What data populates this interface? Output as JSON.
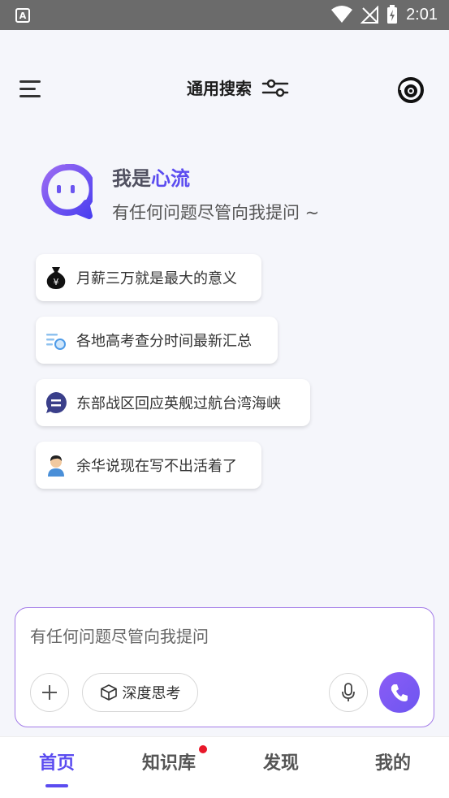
{
  "status_bar": {
    "app_badge": "A",
    "time": "2:01"
  },
  "header": {
    "title": "通用搜索"
  },
  "intro": {
    "title_prefix": "我是",
    "title_brand": "心流",
    "subtitle": "有任何问题尽管向我提问 ~"
  },
  "suggestions": [
    {
      "icon": "money-bag-icon",
      "text": "月薪三万就是最大的意义"
    },
    {
      "icon": "search-list-icon",
      "text": "各地高考查分时间最新汇总"
    },
    {
      "icon": "chat-bubble-icon",
      "text": "东部战区回应英舰过航台湾海峡"
    },
    {
      "icon": "person-avatar-icon",
      "text": "余华说现在写不出活着了"
    }
  ],
  "composer": {
    "placeholder": "有任何问题尽管向我提问",
    "deep_think_label": "深度思考"
  },
  "tabs": [
    {
      "label": "首页",
      "active": true
    },
    {
      "label": "知识库",
      "active": false,
      "badge": true
    },
    {
      "label": "发现",
      "active": false
    },
    {
      "label": "我的",
      "active": false
    }
  ],
  "colors": {
    "accent": "#5b4cf0",
    "badge": "#e8182a",
    "input_border": "#a37be8"
  }
}
